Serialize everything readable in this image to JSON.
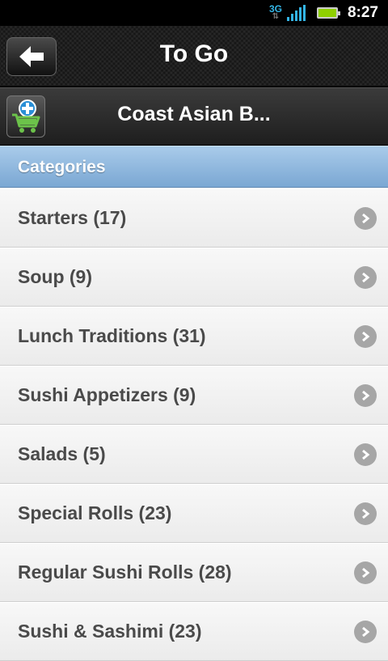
{
  "status_bar": {
    "network": "3G",
    "network_arrows": "⇅",
    "time": "8:27"
  },
  "title_bar": {
    "title": "To Go"
  },
  "restaurant_bar": {
    "name": "Coast Asian B..."
  },
  "categories": {
    "header": "Categories",
    "items": [
      {
        "label": "Starters (17)"
      },
      {
        "label": "Soup (9)"
      },
      {
        "label": "Lunch Traditions (31)"
      },
      {
        "label": "Sushi Appetizers (9)"
      },
      {
        "label": "Salads (5)"
      },
      {
        "label": "Special Rolls (23)"
      },
      {
        "label": "Regular Sushi Rolls (28)"
      },
      {
        "label": "Sushi & Sashimi (23)"
      }
    ]
  },
  "colors": {
    "header_blue": "#7aa7d3",
    "battery_green": "#8fd000",
    "signal_blue": "#33b5e5",
    "cart_green": "#6cc24a",
    "cart_plus_blue": "#2a8fd6"
  },
  "icons": {
    "back": "back-arrow-icon",
    "cart": "cart-add-icon",
    "chevron": "chevron-right-icon"
  }
}
